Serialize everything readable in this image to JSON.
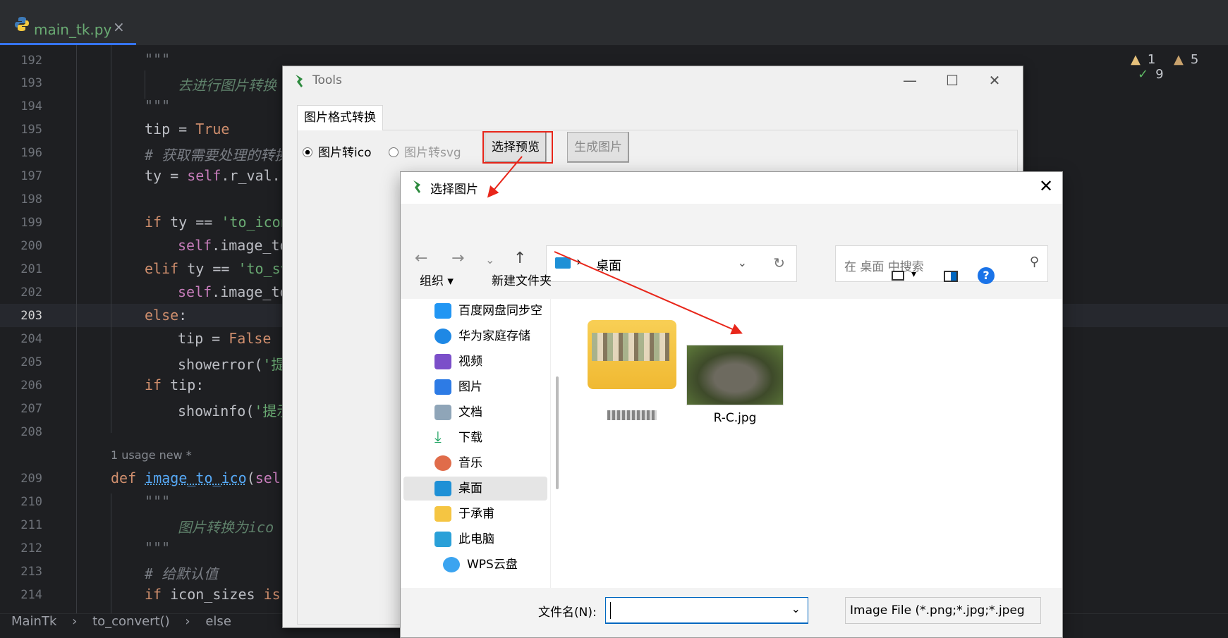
{
  "editor": {
    "tab": "main_tk.py",
    "tab_close": "×",
    "inspections": {
      "warn1": "1",
      "warn2": "5",
      "ok": "9"
    },
    "usage": "1 usage   new *",
    "breadcrumb": [
      "MainTk",
      "›",
      "to_convert()",
      "›",
      "else"
    ],
    "line_numbers": [
      "192",
      "193",
      "194",
      "195",
      "196",
      "197",
      "198",
      "199",
      "200",
      "201",
      "202",
      "203",
      "204",
      "205",
      "206",
      "207",
      "208",
      "209",
      "210",
      "211",
      "212",
      "213",
      "214"
    ]
  },
  "tools": {
    "title": "Tools",
    "tab": "图片格式转换",
    "radio_ico": "图片转ico",
    "radio_svg": "图片转svg",
    "btn_preview": "选择预览",
    "btn_generate": "生成图片",
    "minimize": "—",
    "maximize": "☐",
    "close": "✕"
  },
  "dialog": {
    "title": "选择图片",
    "close": "✕",
    "address": "桌面",
    "search_placeholder": "在 桌面 中搜索",
    "organize": "组织 ▾",
    "new_folder": "新建文件夹",
    "nav": [
      "百度网盘同步空",
      "华为家庭存储",
      "视频",
      "图片",
      "文档",
      "下载",
      "音乐",
      "桌面",
      "于承甫",
      "此电脑",
      "WPS云盘"
    ],
    "files": {
      "file1": "R-C.jpg"
    },
    "filename_label": "文件名(N):",
    "filetype": "Image File (*.png;*.jpg;*.jpeg"
  },
  "colors": {
    "annotation": "#e8261a",
    "accent": "#0067c0"
  }
}
